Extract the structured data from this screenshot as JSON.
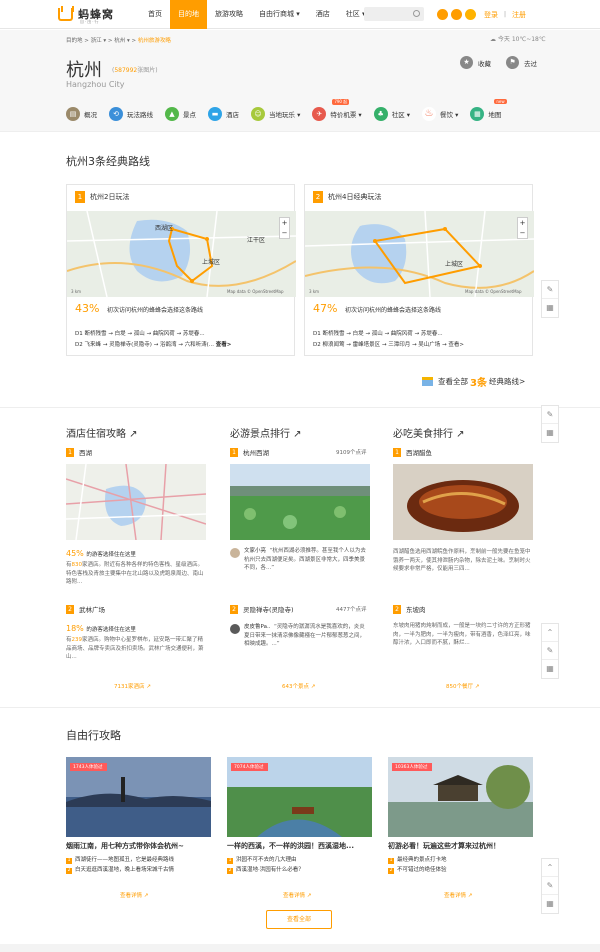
{
  "header": {
    "brand": "蚂蜂窝",
    "brand_sub": "自·由·行",
    "nav": [
      "首页",
      "目的地",
      "旅游攻略",
      "自由行商城 ▾",
      "酒店",
      "社区 ▾"
    ],
    "login": "登录",
    "register": "注册"
  },
  "breadcrumb": {
    "items": [
      "目的地",
      ">",
      "浙江 ▾",
      ">",
      "杭州 ▾",
      ">"
    ],
    "current": "杭州旅游攻略"
  },
  "weather": "今天 10℃~18℃",
  "city": {
    "name": "杭州",
    "photo_count": "587992",
    "photo_suffix": "张图片)",
    "photo_prefix": "(",
    "name_en": "Hangzhou City",
    "fav": "收藏",
    "been": "去过"
  },
  "subnav": [
    {
      "label": "概况",
      "color": "#9b8a6a",
      "icon": "overview-icon"
    },
    {
      "label": "玩法路线",
      "color": "#3b8fd9",
      "icon": "route-icon"
    },
    {
      "label": "景点",
      "color": "#53b84a",
      "icon": "scenic-icon"
    },
    {
      "label": "酒店",
      "color": "#2fa4e7",
      "icon": "hotel-icon"
    },
    {
      "label": "当地玩乐 ▾",
      "color": "#a7c93c",
      "icon": "fun-icon"
    },
    {
      "label": "特价机票 ▾",
      "color": "#e75a4d",
      "icon": "ticket-icon",
      "badge": "790 起"
    },
    {
      "label": "社区 ▾",
      "color": "#35b06a",
      "icon": "community-icon"
    },
    {
      "label": "餐饮 ▾",
      "color": "#f06a4a",
      "icon": "food-icon"
    },
    {
      "label": "地图",
      "color": "#36b384",
      "icon": "map-icon",
      "badge": "new"
    }
  ],
  "routes": {
    "title": "杭州3条经典路线",
    "cards": [
      {
        "num": "1",
        "title": "杭州2日玩法",
        "pct": "43%",
        "desc": "初次访问杭州的蜂蜂会选择这条路线",
        "d1": "D1 断桥残雪 → 白堤 → 孤山 → 曲院风荷 → 苏堤春...",
        "d2": "D2 飞来峰 → 灵隐禅寺(灵隐寺) → 浴鹄湾 → 六和听涛(...",
        "more": "查看>",
        "labels": [
          "西湖区",
          "江干区",
          "上城区"
        ],
        "credit": "Map data © OpenStreetMap",
        "scale": "3 km"
      },
      {
        "num": "2",
        "title": "杭州4日经典玩法",
        "pct": "47%",
        "desc": "初次访问杭州的蜂蜂会选择这条路线",
        "d1": "D1 断桥残雪 → 白堤 → 孤山 → 曲院风荷 → 苏堤春...",
        "d2": "D2 柳浪闻莺 → 雷峰塔景区 → 三潭印月 → 吴山广场 → 查看>",
        "more": "",
        "labels": [
          "上城区"
        ],
        "credit": "Map data © OpenStreetMap",
        "scale": "3 km"
      }
    ],
    "view_all": "查看全部",
    "view_all_num": "3条",
    "view_all_suffix": "经典路线>"
  },
  "columns": {
    "hotel": {
      "title": "酒店住宿攻略 ↗",
      "items": [
        {
          "num": "1",
          "name": "西湖",
          "pct": "45%",
          "pct_txt": "的游客选择住在这里",
          "desc1": "有",
          "count": "830",
          "desc2": "家酒店。附近有各种各样的特色客栈、星级酒店。特色客栈及青旅主要集中在北山路以及虎跑泉周边、南山路附..."
        },
        {
          "num": "2",
          "name": "武林广场",
          "pct": "18%",
          "pct_txt": "的游客选择住在这里",
          "desc1": "有",
          "count": "239",
          "desc2": "家酒店。购物中心星罗棋布，延安路一带汇聚了精品商场、品牌专卖店及折扣卖场。武林广场交通便利，萧山..."
        }
      ],
      "more": "7131家酒店 ↗"
    },
    "scenic": {
      "title": "必游景点排行 ↗",
      "items": [
        {
          "num": "1",
          "name": "杭州西湖",
          "reviews": "9109个点评",
          "user": "文家小亮",
          "quote": "“杭州西湖必须推荐。甚至我个人以为去杭州只去西湖便足矣。西湖景区非常大，四季美景不同，各...”"
        },
        {
          "num": "2",
          "name": "灵隐禅寺(灵隐寺)",
          "reviews": "4477个点评",
          "user": "皮皮鲁Pa..",
          "quote": "“灵隐寺的潺潺流水是我喜欢的，炎炎夏日带来一抹清凉佛像藏襁在一片郁郁葱葱之间，相映成趣。...”"
        }
      ],
      "more": "643个景点 ↗"
    },
    "food": {
      "title": "必吃美食排行 ↗",
      "items": [
        {
          "num": "1",
          "name": "西湖醋鱼",
          "desc": "西湖醋鱼选用西湖鲩鱼作原料，烹制前一般先要在鱼笼中饿养一两天，使其排泄肠内杂物，除去泥土味。烹制时火候要求非常严格，仅能用三四..."
        },
        {
          "num": "2",
          "name": "东坡肉",
          "desc": "东坡肉用猪肉炖制而成，一般是一块约二寸许的方正形猪肉，一半为肥肉，一半为瘦肉，带有酒香，色泽红亮，味醇汁浓，入口即而不腻，酥烂..."
        }
      ],
      "more": "850个餐厅 ↗"
    }
  },
  "guides": {
    "title": "自由行攻略",
    "cards": [
      {
        "tag": "1743人体验过",
        "title": "烟雨江南，用七种方式带你体会杭州~",
        "l1": "西湖徒行——地图孤丑，它是最经典路线",
        "l2": "白天逛逛西溪湿地，晚上看场宋城千古情",
        "more": "查看详情 ↗"
      },
      {
        "tag": "7074人体验过",
        "title": "一样的西溪，不一样的洪园！西溪湿地...",
        "l1": "洪园不可不去的几大理由",
        "l2": "西溪湿地·洪园有什么必看？",
        "more": "查看详情 ↗"
      },
      {
        "tag": "10363人体验过",
        "title": "初游必看！玩遍这些才算来过杭州！",
        "l1": "最经典的景点打卡地",
        "l2": "不可错过的绝佳体验",
        "more": "查看详情 ↗"
      }
    ],
    "view_all": "查看全部"
  }
}
